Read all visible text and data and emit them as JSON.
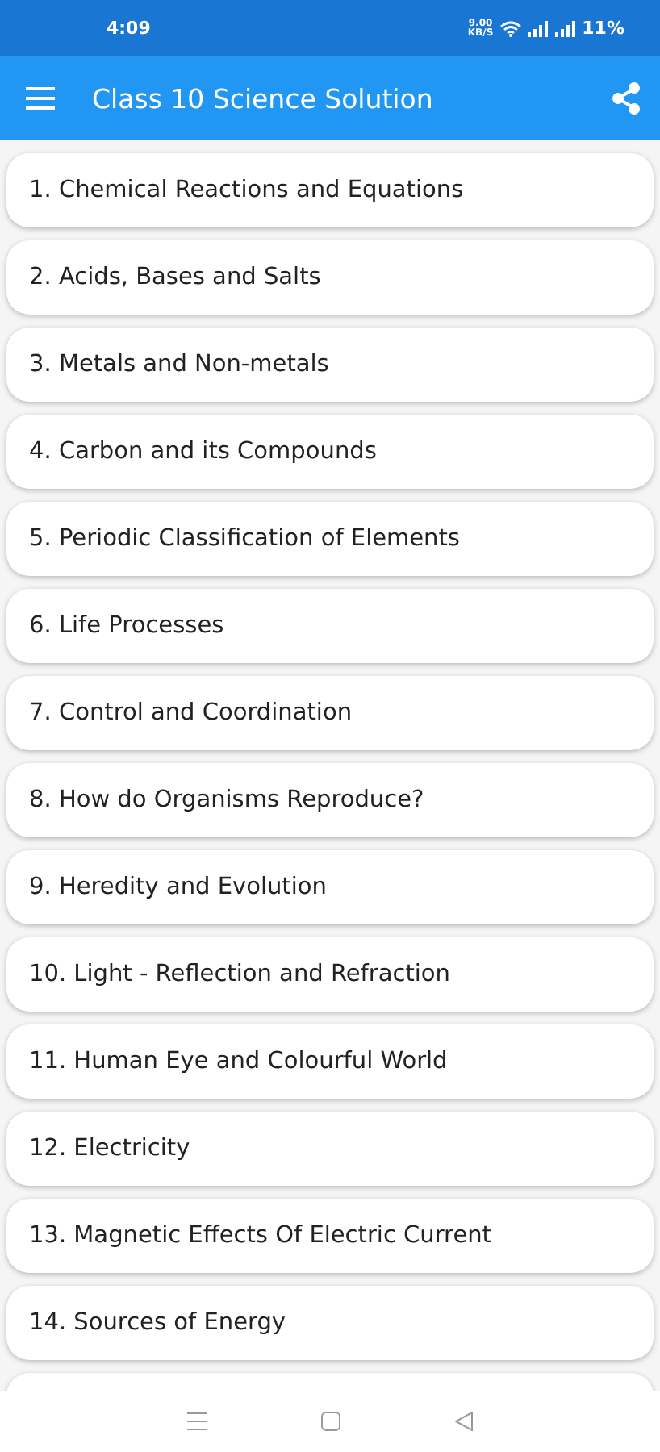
{
  "status_bar": {
    "time": "4:09",
    "net_speed": "9.00",
    "net_unit": "KB/S",
    "battery": "11%"
  },
  "app_bar": {
    "title": "Class 10 Science Solution"
  },
  "chapters": [
    {
      "label": "1. Chemical Reactions and Equations"
    },
    {
      "label": "2. Acids, Bases and Salts"
    },
    {
      "label": "3. Metals and Non-metals"
    },
    {
      "label": "4. Carbon and its Compounds"
    },
    {
      "label": "5. Periodic Classification of Elements"
    },
    {
      "label": "6. Life Processes"
    },
    {
      "label": "7. Control and Coordination"
    },
    {
      "label": "8. How do Organisms Reproduce?"
    },
    {
      "label": "9. Heredity and Evolution"
    },
    {
      "label": "10. Light - Reflection and Refraction"
    },
    {
      "label": "11. Human Eye and Colourful World"
    },
    {
      "label": "12. Electricity"
    },
    {
      "label": "13. Magnetic Effects Of Electric Current"
    },
    {
      "label": "14. Sources of Energy"
    }
  ]
}
